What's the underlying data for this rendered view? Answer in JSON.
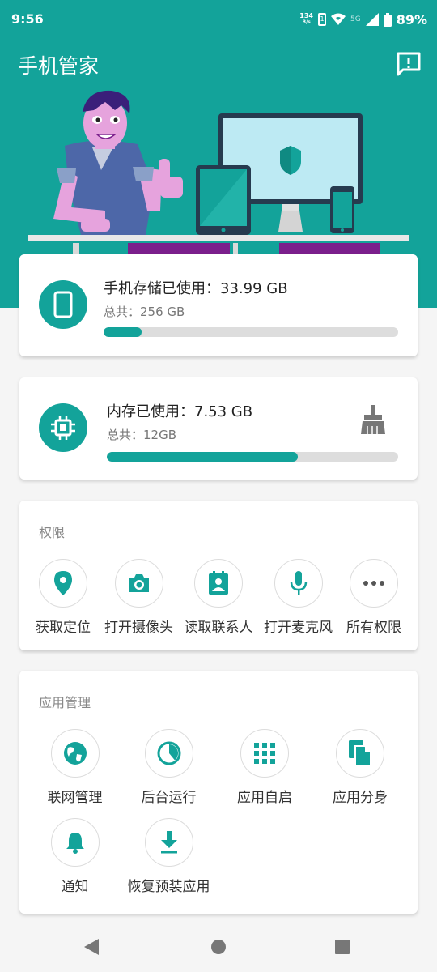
{
  "status": {
    "time": "9:56",
    "netspeed_value": "134",
    "netspeed_unit": "B/s",
    "network": "5G",
    "battery": "89%"
  },
  "header": {
    "title": "手机管家"
  },
  "storage": {
    "title": "手机存储已使用：33.99 GB",
    "total": "总共：256 GB",
    "progress": 0.13
  },
  "memory": {
    "title": "内存已使用：7.53 GB",
    "total": "总共：12GB",
    "progress": 0.655
  },
  "permissions": {
    "title": "权限",
    "items": [
      {
        "label": "获取定位",
        "icon": "location-icon"
      },
      {
        "label": "打开摄像头",
        "icon": "camera-icon"
      },
      {
        "label": "读取联系人",
        "icon": "contacts-icon"
      },
      {
        "label": "打开麦克风",
        "icon": "microphone-icon"
      },
      {
        "label": "所有权限",
        "icon": "more-icon"
      }
    ]
  },
  "apps": {
    "title": "应用管理",
    "items": [
      {
        "label": "联网管理",
        "icon": "globe-icon"
      },
      {
        "label": "后台运行",
        "icon": "pie-icon"
      },
      {
        "label": "应用自启",
        "icon": "grid-icon"
      },
      {
        "label": "应用分身",
        "icon": "copy-icon"
      },
      {
        "label": "通知",
        "icon": "bell-icon"
      },
      {
        "label": "恢复预装应用",
        "icon": "download-icon"
      }
    ]
  },
  "colors": {
    "primary": "#13a39a",
    "purple": "#7b1f8c"
  }
}
